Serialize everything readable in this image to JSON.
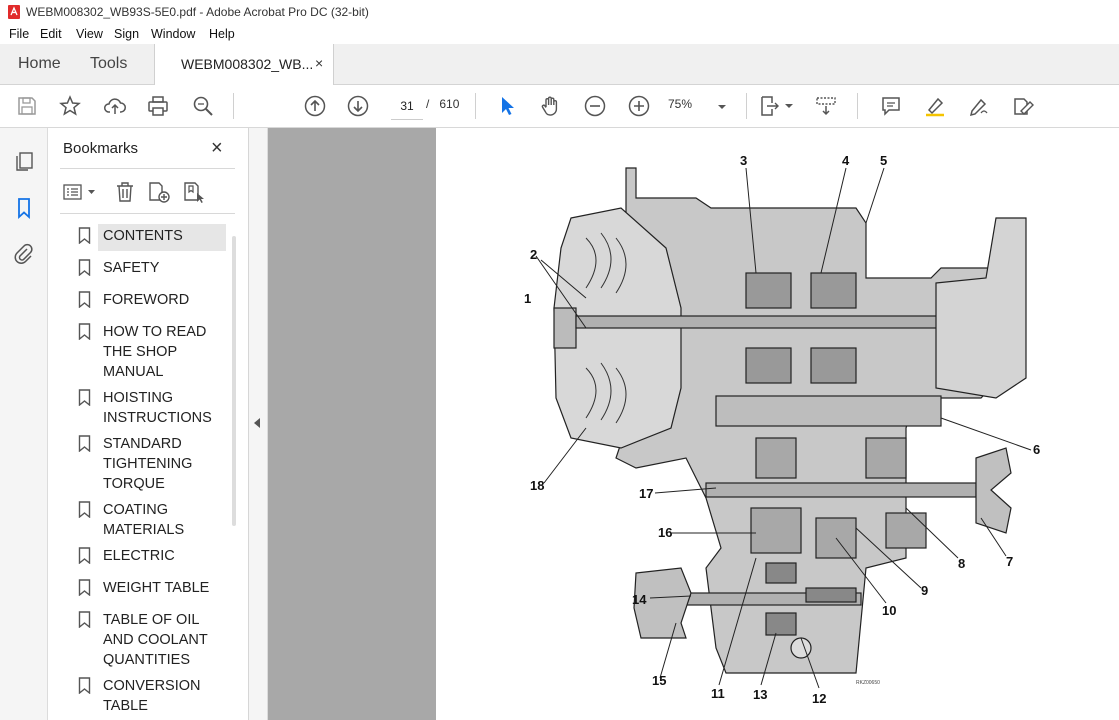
{
  "window": {
    "title": "WEBM008302_WB93S-5E0.pdf - Adobe Acrobat Pro DC (32-bit)"
  },
  "menu": [
    "File",
    "Edit",
    "View",
    "Sign",
    "Window",
    "Help"
  ],
  "tabs": {
    "home": "Home",
    "tools": "Tools",
    "document": "WEBM008302_WB...",
    "close_glyph": "×"
  },
  "toolbar": {
    "icons": [
      "save-icon",
      "bookmark-star-icon",
      "upload-icon",
      "print-icon",
      "find-icon",
      "page-up-icon",
      "page-down-icon",
      "select-cursor-icon",
      "hand-icon",
      "zoom-out-icon",
      "zoom-in-icon",
      "fit-page-icon",
      "scroll-mode-icon",
      "comment-icon",
      "highlight-icon",
      "sign-icon",
      "fill-sign-icon"
    ],
    "current_page": "31",
    "page_separator": "/",
    "total_pages": "610",
    "zoom": "75%",
    "accent_color": "#1473e6"
  },
  "bookmarks": {
    "title": "Bookmarks",
    "close_glyph": "×",
    "items": [
      {
        "label": "CONTENTS",
        "selected": true
      },
      {
        "label": "SAFETY"
      },
      {
        "label": "FOREWORD"
      },
      {
        "label": "HOW TO READ\nTHE SHOP\nMANUAL"
      },
      {
        "label": "HOISTING\nINSTRUCTIONS"
      },
      {
        "label": "STANDARD\nTIGHTENING\nTORQUE"
      },
      {
        "label": "COATING\nMATERIALS"
      },
      {
        "label": "ELECTRIC"
      },
      {
        "label": "WEIGHT TABLE"
      },
      {
        "label": "TABLE OF OIL\nAND COOLANT\nQUANTITIES"
      },
      {
        "label": "CONVERSION\nTABLE"
      }
    ]
  },
  "diagram": {
    "callouts": [
      "1",
      "2",
      "3",
      "4",
      "5",
      "6",
      "7",
      "8",
      "9",
      "10",
      "11",
      "12",
      "13",
      "14",
      "15",
      "16",
      "17",
      "18"
    ],
    "figure_code": "RKZ00650"
  }
}
